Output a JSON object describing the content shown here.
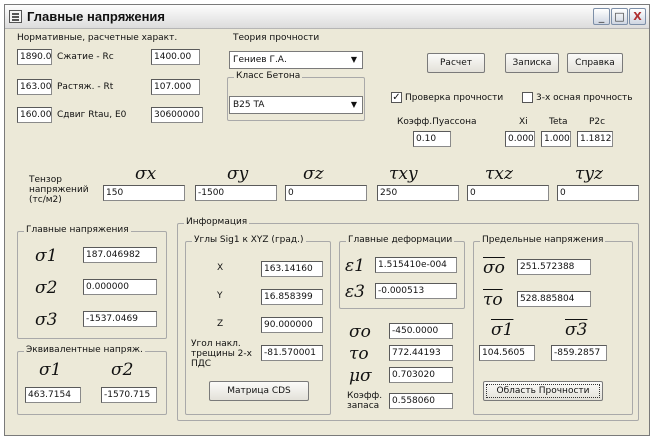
{
  "window": {
    "title": "Главные напряжения",
    "min": "_",
    "max": "□",
    "close": "X"
  },
  "norm": {
    "label": "Нормативные, расчетные характ.",
    "rows": [
      {
        "left": "1890.0",
        "name": "Сжатие - Rc",
        "right": "1400.00"
      },
      {
        "left": "163.00",
        "name": "Растяж. - Rt",
        "right": "107.000"
      },
      {
        "left": "160.00",
        "name": "Сдвиг Rtau, E0",
        "right": "30600000"
      }
    ]
  },
  "theory": {
    "label": "Теория прочности",
    "value": "Гениев Г.А."
  },
  "concrete": {
    "label": "Класс Бетона",
    "value": "B25 TA"
  },
  "buttons": {
    "calc": "Расчет",
    "note": "Записка",
    "help": "Справка",
    "cds": "Матрица CDS",
    "region": "Область Прочности"
  },
  "checks": {
    "verify": {
      "label": "Проверка прочности",
      "checked": true
    },
    "triaxial": {
      "label": "3-х осная прочность",
      "checked": false
    }
  },
  "params": {
    "poisson_label": "Коэфф.Пуассона",
    "poisson": "0.10",
    "xi_label": "Xi",
    "xi": "0.000",
    "teta_label": "Teta",
    "teta": "1.000",
    "p2c_label": "P2c",
    "p2c": "1.1812"
  },
  "tensor": {
    "label": "Тензор напряжений (тс/м2)",
    "symbols": [
      "σx",
      "σy",
      "σz",
      "τxy",
      "τxz",
      "τyz"
    ],
    "values": [
      "150",
      "-1500",
      "0",
      "250",
      "0",
      "0"
    ]
  },
  "principal": {
    "label": "Главные напряжения",
    "sym1": "σ1",
    "sym2": "σ2",
    "sym3": "σ3",
    "s1": "187.046982",
    "s2": "0.000000",
    "s3": "-1537.0469"
  },
  "equivalent": {
    "label": "Эквивалентные напряж.",
    "sym1": "σ1",
    "sym2": "σ2",
    "v1": "463.7154",
    "v2": "-1570.715"
  },
  "info": {
    "label": "Информация",
    "angles_label": "Углы Sig1 к XYZ (град.)",
    "x_label": "X",
    "x": "163.14160",
    "y_label": "Y",
    "y": "16.858399",
    "z_label": "Z",
    "z": "90.000000",
    "tilt_label": "Угол накл. трещины 2-х ПДС",
    "tilt": "-81.570001"
  },
  "deformations": {
    "label": "Главные деформации",
    "e1_sym": "ε1",
    "e3_sym": "ε3",
    "e1": "1.515410e-004",
    "e3": "-0.000513"
  },
  "octa": {
    "sig_sym": "σo",
    "tau_sym": "τo",
    "mu_sym": "μσ",
    "sig": "-450.0000",
    "tau": "772.44193",
    "mu": "0.703020",
    "k_label": "Коэфф. запаса",
    "k": "0.558060"
  },
  "limit": {
    "label": "Предельные напряжения",
    "sig0_sym": "σo",
    "tau0_sym": "τo",
    "s1_sym": "σ1",
    "s3_sym": "σ3",
    "sig0": "251.572388",
    "tau0": "528.885804",
    "s1": "104.5605",
    "s3": "-859.2857"
  }
}
